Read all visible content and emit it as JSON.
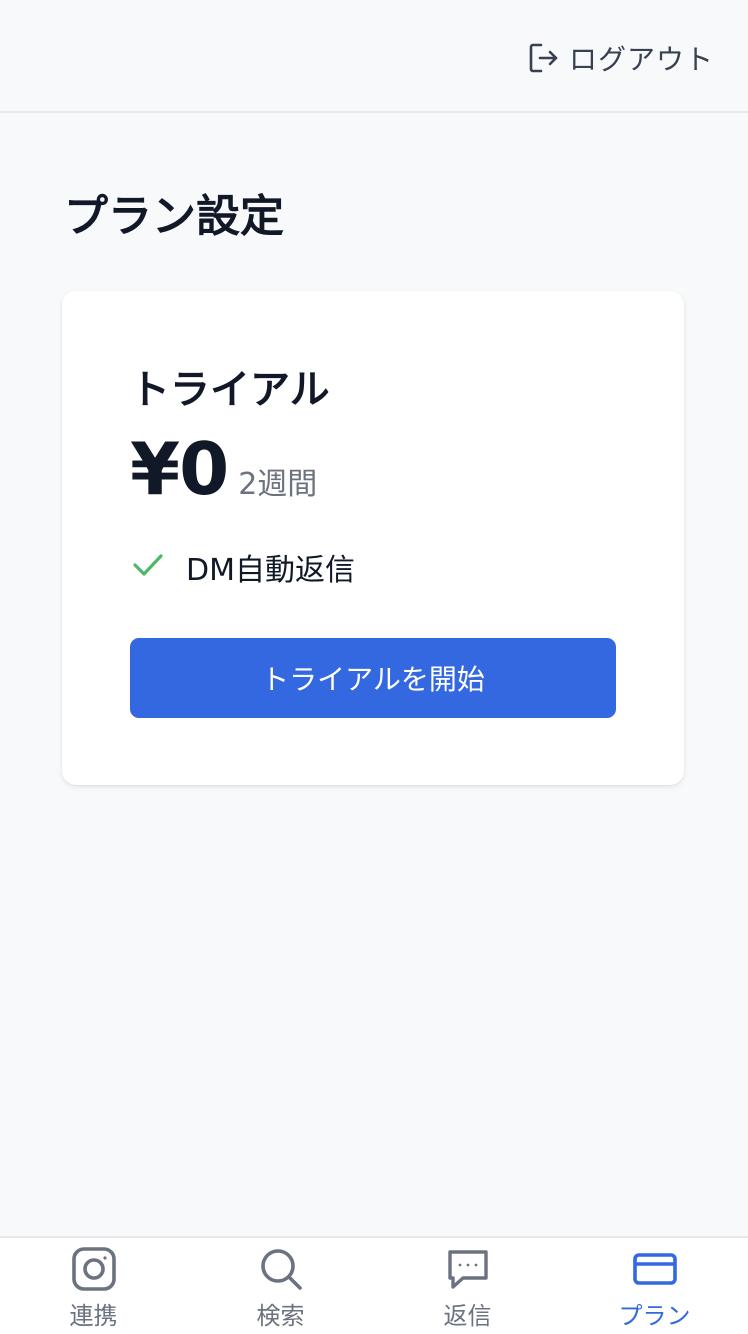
{
  "header": {
    "logout_label": "ログアウト",
    "logout_icon": "logout-icon"
  },
  "page": {
    "title": "プラン設定"
  },
  "plan_card": {
    "name": "トライアル",
    "price": "¥0",
    "period": "2週間",
    "features": [
      {
        "icon": "check-icon",
        "label": "DM自動返信"
      }
    ],
    "cta_label": "トライアルを開始"
  },
  "bottom_nav": {
    "items": [
      {
        "icon": "instagram-icon",
        "label": "連携",
        "active": false
      },
      {
        "icon": "search-icon",
        "label": "検索",
        "active": false
      },
      {
        "icon": "chat-bubble-icon",
        "label": "返信",
        "active": false
      },
      {
        "icon": "credit-card-icon",
        "label": "プラン",
        "active": true
      }
    ]
  },
  "colors": {
    "accent": "#3368e0",
    "check": "#4cb96a",
    "background": "#f8f9fb",
    "muted_text": "#6b7280"
  }
}
